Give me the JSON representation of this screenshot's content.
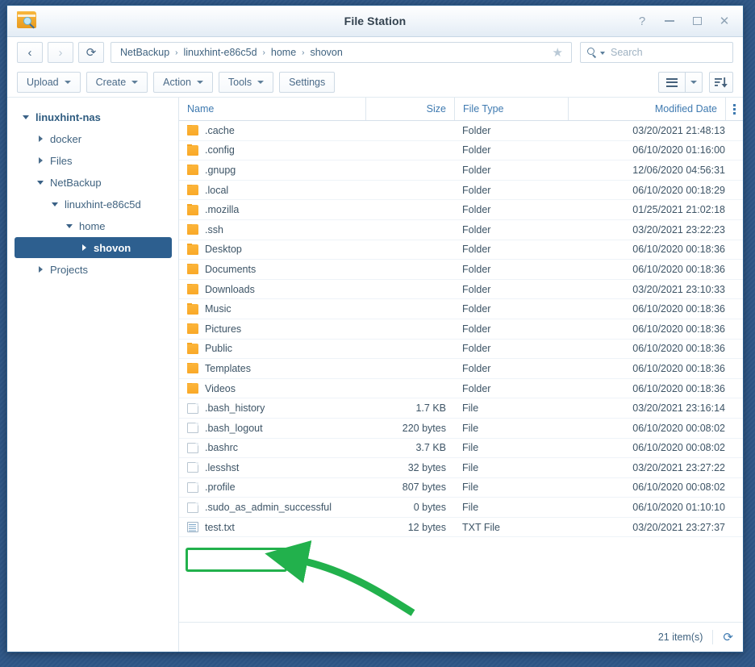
{
  "window": {
    "title": "File Station",
    "icon": "folder-search-icon",
    "controls": {
      "help": "?",
      "minimize": "minimize-icon",
      "maximize": "maximize-icon",
      "close": "✕"
    }
  },
  "nav": {
    "back": "‹",
    "forward": "›",
    "refresh": "⟳",
    "breadcrumb": [
      "NetBackup",
      "linuxhint-e86c5d",
      "home",
      "shovon"
    ],
    "separator": "›",
    "favorite_icon": "★"
  },
  "search": {
    "placeholder": "Search",
    "value": ""
  },
  "toolbar": {
    "buttons": [
      {
        "label": "Upload",
        "has_caret": true
      },
      {
        "label": "Create",
        "has_caret": true
      },
      {
        "label": "Action",
        "has_caret": true
      },
      {
        "label": "Tools",
        "has_caret": true
      },
      {
        "label": "Settings",
        "has_caret": false
      }
    ],
    "view_mode_icon": "list-view-icon",
    "view_mode_caret": "▾",
    "sort_icon": "sort-descending-icon"
  },
  "sidebar": {
    "items": [
      {
        "label": "linuxhint-nas",
        "depth": 0,
        "expanded": true,
        "selected": false,
        "root": true
      },
      {
        "label": "docker",
        "depth": 1,
        "expanded": false,
        "selected": false,
        "root": false
      },
      {
        "label": "Files",
        "depth": 1,
        "expanded": false,
        "selected": false,
        "root": false
      },
      {
        "label": "NetBackup",
        "depth": 1,
        "expanded": true,
        "selected": false,
        "root": false
      },
      {
        "label": "linuxhint-e86c5d",
        "depth": 2,
        "expanded": true,
        "selected": false,
        "root": false
      },
      {
        "label": "home",
        "depth": 3,
        "expanded": true,
        "selected": false,
        "root": false
      },
      {
        "label": "shovon",
        "depth": 4,
        "expanded": false,
        "selected": true,
        "root": false
      },
      {
        "label": "Projects",
        "depth": 1,
        "expanded": false,
        "selected": false,
        "root": false
      }
    ]
  },
  "table": {
    "columns": [
      "Name",
      "Size",
      "File Type",
      "Modified Date"
    ],
    "rows": [
      {
        "icon": "folder",
        "name": ".cache",
        "size": "",
        "type": "Folder",
        "modified": "03/20/2021 21:48:13"
      },
      {
        "icon": "folder",
        "name": ".config",
        "size": "",
        "type": "Folder",
        "modified": "06/10/2020 01:16:00"
      },
      {
        "icon": "folder",
        "name": ".gnupg",
        "size": "",
        "type": "Folder",
        "modified": "12/06/2020 04:56:31"
      },
      {
        "icon": "folder",
        "name": ".local",
        "size": "",
        "type": "Folder",
        "modified": "06/10/2020 00:18:29"
      },
      {
        "icon": "folder",
        "name": ".mozilla",
        "size": "",
        "type": "Folder",
        "modified": "01/25/2021 21:02:18"
      },
      {
        "icon": "folder",
        "name": ".ssh",
        "size": "",
        "type": "Folder",
        "modified": "03/20/2021 23:22:23"
      },
      {
        "icon": "folder",
        "name": "Desktop",
        "size": "",
        "type": "Folder",
        "modified": "06/10/2020 00:18:36"
      },
      {
        "icon": "folder",
        "name": "Documents",
        "size": "",
        "type": "Folder",
        "modified": "06/10/2020 00:18:36"
      },
      {
        "icon": "folder",
        "name": "Downloads",
        "size": "",
        "type": "Folder",
        "modified": "03/20/2021 23:10:33"
      },
      {
        "icon": "folder",
        "name": "Music",
        "size": "",
        "type": "Folder",
        "modified": "06/10/2020 00:18:36"
      },
      {
        "icon": "folder",
        "name": "Pictures",
        "size": "",
        "type": "Folder",
        "modified": "06/10/2020 00:18:36"
      },
      {
        "icon": "folder",
        "name": "Public",
        "size": "",
        "type": "Folder",
        "modified": "06/10/2020 00:18:36"
      },
      {
        "icon": "folder",
        "name": "Templates",
        "size": "",
        "type": "Folder",
        "modified": "06/10/2020 00:18:36"
      },
      {
        "icon": "folder",
        "name": "Videos",
        "size": "",
        "type": "Folder",
        "modified": "06/10/2020 00:18:36"
      },
      {
        "icon": "file",
        "name": ".bash_history",
        "size": "1.7 KB",
        "type": "File",
        "modified": "03/20/2021 23:16:14"
      },
      {
        "icon": "file",
        "name": ".bash_logout",
        "size": "220 bytes",
        "type": "File",
        "modified": "06/10/2020 00:08:02"
      },
      {
        "icon": "file",
        "name": ".bashrc",
        "size": "3.7 KB",
        "type": "File",
        "modified": "06/10/2020 00:08:02"
      },
      {
        "icon": "file",
        "name": ".lesshst",
        "size": "32 bytes",
        "type": "File",
        "modified": "03/20/2021 23:27:22"
      },
      {
        "icon": "file",
        "name": ".profile",
        "size": "807 bytes",
        "type": "File",
        "modified": "06/10/2020 00:08:02"
      },
      {
        "icon": "file",
        "name": ".sudo_as_admin_successful",
        "size": "0 bytes",
        "type": "File",
        "modified": "06/10/2020 01:10:10"
      },
      {
        "icon": "txt",
        "name": "test.txt",
        "size": "12 bytes",
        "type": "TXT File",
        "modified": "03/20/2021 23:27:37"
      }
    ]
  },
  "status": {
    "item_count": "21 item(s)",
    "refresh_icon": "⟳"
  },
  "annotation": {
    "color": "#22b14c",
    "target": "test.txt",
    "shape": "rounded-rectangle-with-curved-arrow"
  },
  "colors": {
    "desktop": "#2d5585",
    "accent_blue": "#3f7ab0",
    "selected_row": "#2d5f8f",
    "folder_icon": "#f9a928",
    "annotation_green": "#22b14c"
  }
}
